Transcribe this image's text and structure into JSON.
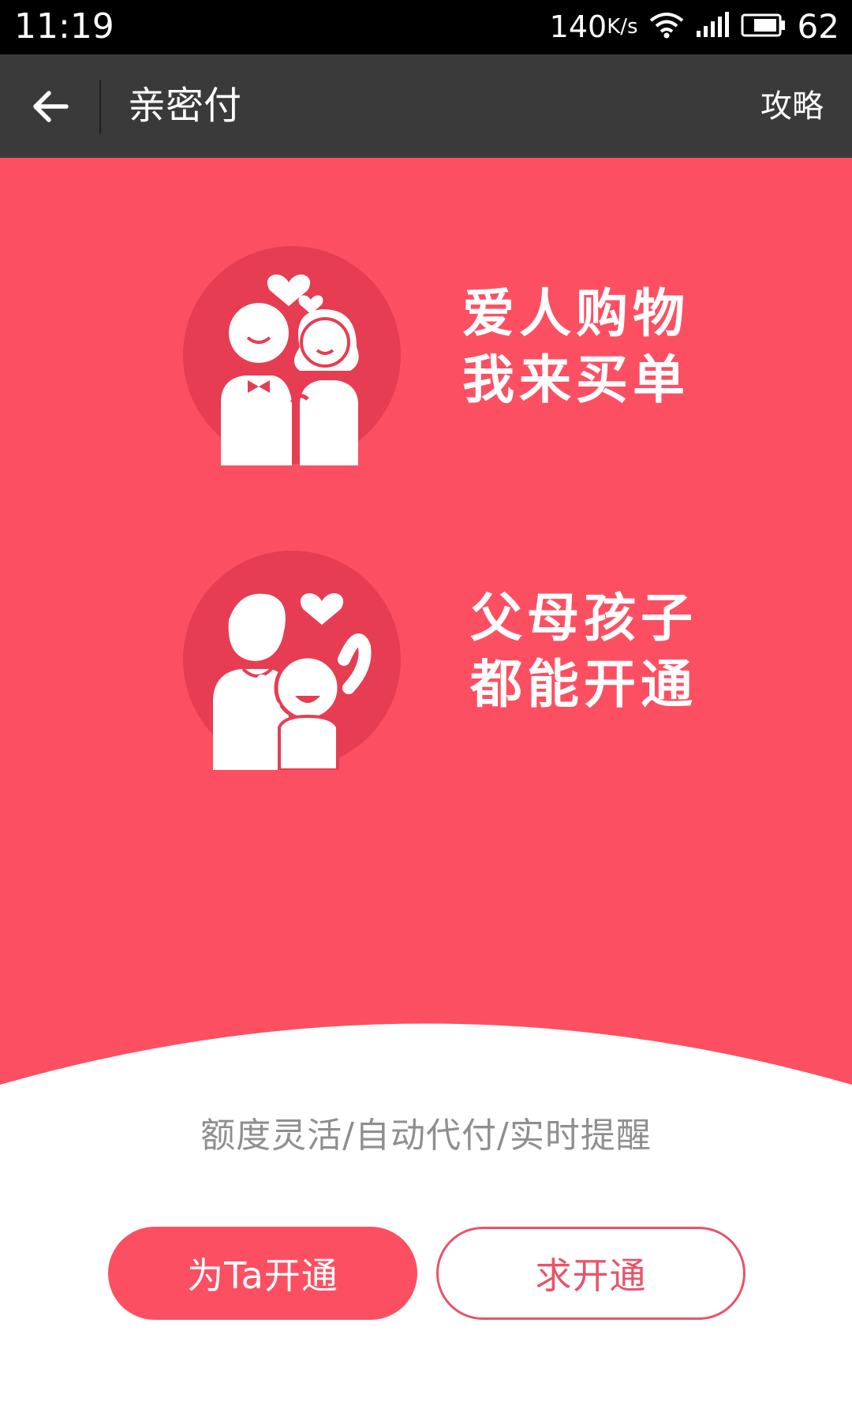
{
  "status_bar": {
    "time": "11:19",
    "network_speed": "140",
    "network_speed_unit": "K/s",
    "battery_level": "62"
  },
  "app_bar": {
    "title": "亲密付",
    "action_label": "攻略",
    "back_icon": "arrow-left-icon"
  },
  "features": [
    {
      "icon": "couple-icon",
      "line1": "爱人购物",
      "line2": "我来买单"
    },
    {
      "icon": "parent-child-icon",
      "line1": "父母孩子",
      "line2": "都能开通"
    }
  ],
  "tagline": "额度灵活/自动代付/实时提醒",
  "buttons": {
    "primary_label": "为Ta开通",
    "secondary_label": "求开通"
  },
  "colors": {
    "accent": "#fd4f62",
    "circle": "#e63d52",
    "app_bar": "#3a3a3a",
    "tagline": "#8f8f8f"
  }
}
